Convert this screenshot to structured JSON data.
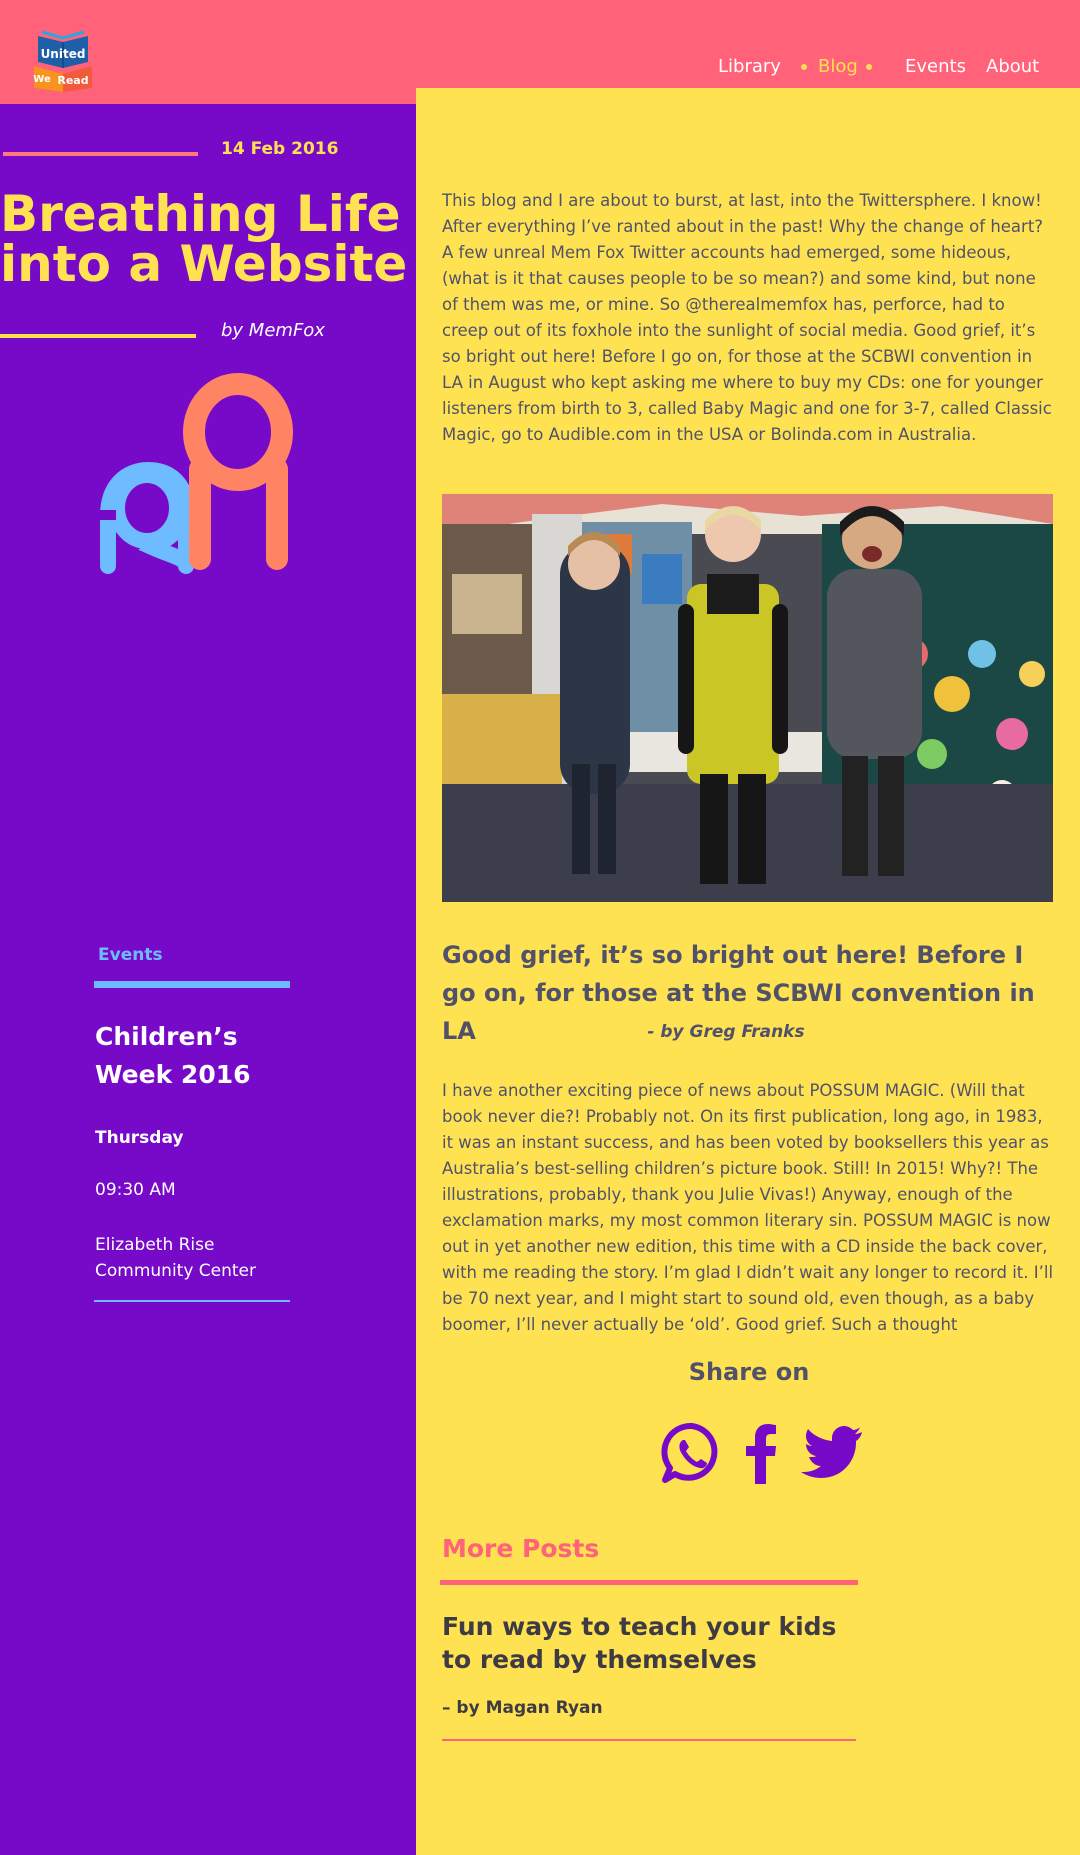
{
  "header": {
    "logo_text_1": "United",
    "logo_text_2": "We",
    "logo_text_3": "Read",
    "nav": {
      "library": "Library",
      "blog": "Blog",
      "events": "Events",
      "about": "About"
    },
    "colors": {
      "background": "#ff6279",
      "active": "#ffe252"
    }
  },
  "post": {
    "date": "14 Feb 2016",
    "title": "Breathing Life into a Website",
    "author": "by MemFox",
    "intro": "This blog and I are about to burst, at last, into the Twittersphere. I know! After everything I’ve ranted about in the past! Why the change of heart? A few unreal Mem Fox Twitter accounts had emerged, some hideous, (what is it that causes people to be so mean?) and some kind, but none of them was me, or mine. So @therealmemfox has, perforce, had to creep out of its foxhole into the sunlight of social media. Good grief, it’s so bright out here! Before I go on, for those at the SCBWI convention in LA in August who kept asking me where to buy my CDs: one for younger listeners from birth to 3, called Baby Magic and one for 3-7, called Classic Magic, go to Audible.com in the USA or Bolinda.com in Australia.",
    "quote": "Good grief, it’s so bright out here! Before I go on, for those at the SCBWI convention in LA",
    "quote_author": "- by Greg Franks",
    "body": "I have another exciting piece of news about POSSUM MAGIC. (Will that book never die?! Probably not. On its first publication, long ago, in 1983, it was an instant success, and has been voted by booksellers this year as Australia’s best-selling children’s picture book. Still! In 2015! Why?! The illustrations, probably, thank you Julie Vivas!) Anyway, enough of the exclamation marks, my most common literary sin. POSSUM MAGIC is now out in yet another new edition, this time with a CD inside the back cover, with me reading the story. I’m glad I didn’t wait any longer to record it. I’ll be 70 next year, and I might start to sound old, even though, as a baby boomer, I’ll never actually be ‘old’. Good grief. Such a thought"
  },
  "event": {
    "section_label": "Events",
    "title": "Children’s Week 2016",
    "day": "Thursday",
    "time": "09:30 AM",
    "location": "Elizabeth Rise Community Center"
  },
  "share": {
    "label": "Share on",
    "icons": [
      "whatsapp-icon",
      "facebook-icon",
      "twitter-icon"
    ],
    "icon_color": "#7709c9"
  },
  "more_posts": {
    "label": "More Posts",
    "title": "Fun ways to teach your kids to read by themselves",
    "author": "– by Magan Ryan"
  },
  "colors": {
    "sidebar": "#7709c9",
    "content": "#ffe252",
    "accent_blue": "#6fbbff",
    "accent_pink": "#ff6279",
    "text": "#51526a"
  }
}
